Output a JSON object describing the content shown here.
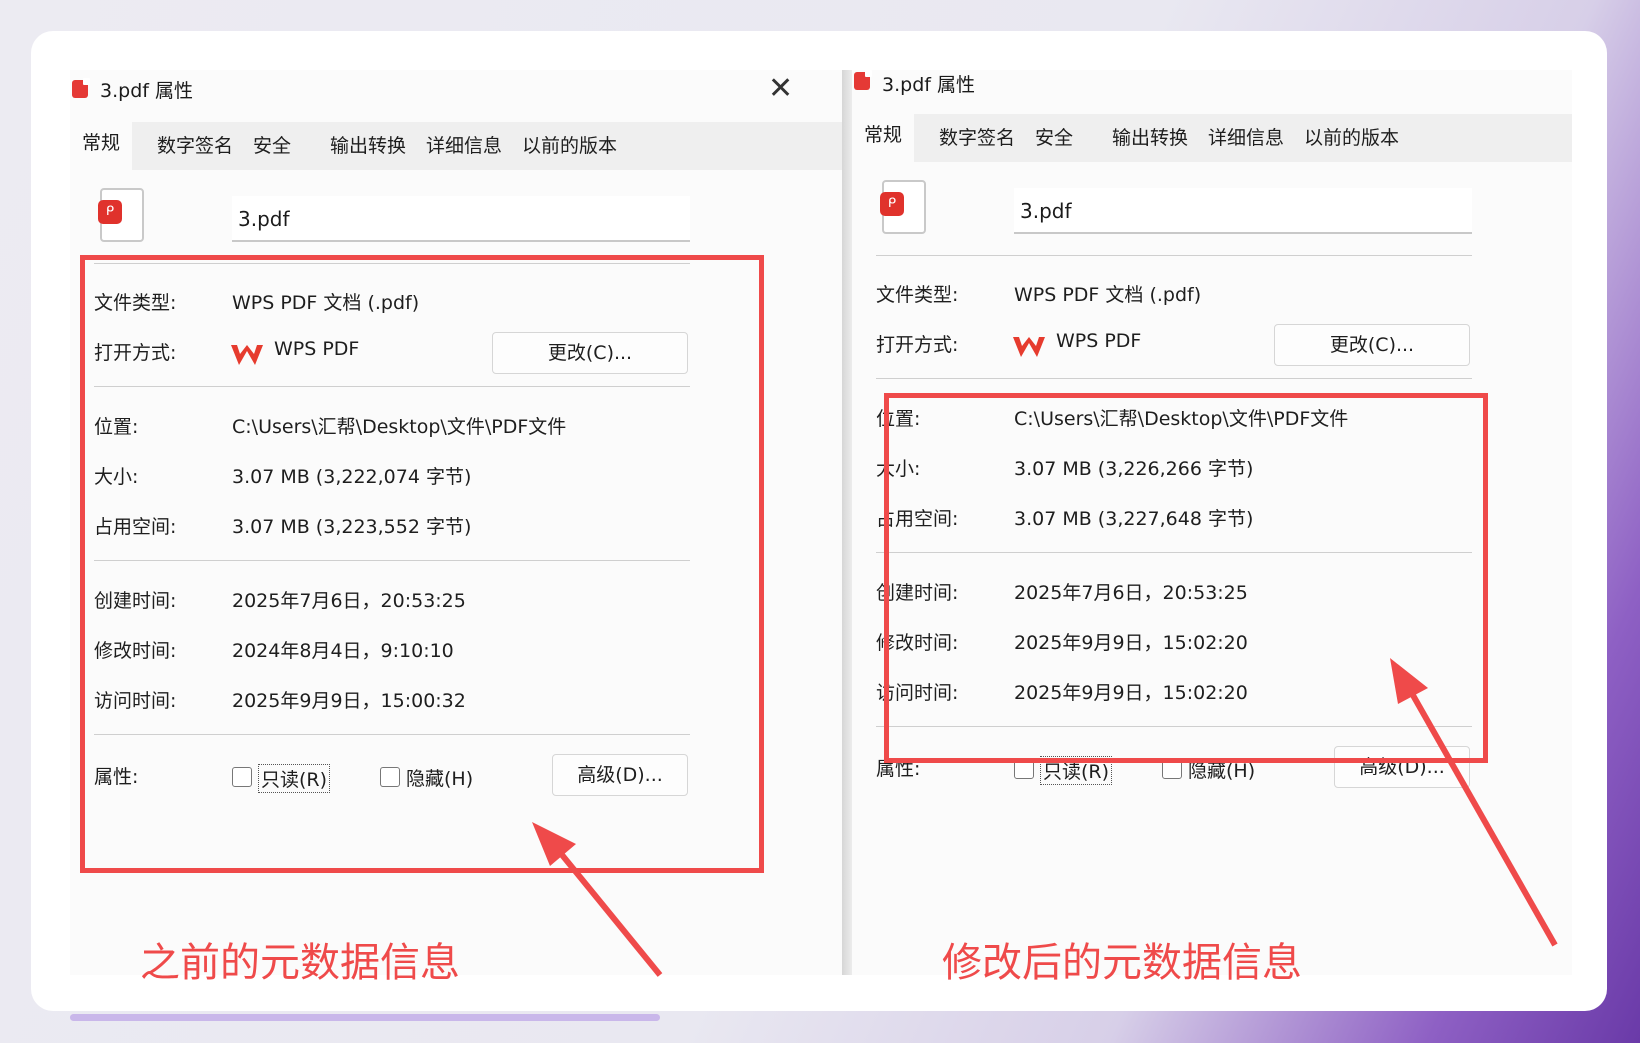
{
  "left": {
    "window_title": "3.pdf 属性",
    "tabs": [
      "常规",
      "数字签名",
      "安全",
      "输出转换",
      "详细信息",
      "以前的版本"
    ],
    "file_name": "3.pdf",
    "rows": {
      "type_label": "文件类型:",
      "type_value": "WPS PDF 文档 (.pdf)",
      "open_label": "打开方式:",
      "open_value": "WPS PDF",
      "change_button": "更改(C)...",
      "location_label": "位置:",
      "location_value": "C:\\Users\\汇帮\\Desktop\\文件\\PDF文件",
      "size_label": "大小:",
      "size_value": "3.07 MB (3,222,074 字节)",
      "disk_label": "占用空间:",
      "disk_value": "3.07 MB (3,223,552 字节)",
      "created_label": "创建时间:",
      "created_value": "2025年7月6日，20:53:25",
      "modified_label": "修改时间:",
      "modified_value": "2024年8月4日，9:10:10",
      "accessed_label": "访问时间:",
      "accessed_value": "2025年9月9日，15:00:32",
      "attr_label": "属性:",
      "readonly_label": "只读(R)",
      "hidden_label": "隐藏(H)",
      "advanced_button": "高级(D)..."
    },
    "caption": "之前的元数据信息"
  },
  "right": {
    "window_title": "3.pdf 属性",
    "tabs": [
      "常规",
      "数字签名",
      "安全",
      "输出转换",
      "详细信息",
      "以前的版本"
    ],
    "file_name": "3.pdf",
    "rows": {
      "type_label": "文件类型:",
      "type_value": "WPS PDF 文档 (.pdf)",
      "open_label": "打开方式:",
      "open_value": "WPS PDF",
      "change_button": "更改(C)...",
      "location_label": "位置:",
      "location_value": "C:\\Users\\汇帮\\Desktop\\文件\\PDF文件",
      "size_label": "大小:",
      "size_value": "3.07 MB (3,226,266 字节)",
      "disk_label": "占用空间:",
      "disk_value": "3.07 MB (3,227,648 字节)",
      "created_label": "创建时间:",
      "created_value": "2025年7月6日，20:53:25",
      "modified_label": "修改时间:",
      "modified_value": "2025年9月9日，15:02:20",
      "accessed_label": "访问时间:",
      "accessed_value": "2025年9月9日，15:02:20",
      "attr_label": "属性:",
      "readonly_label": "只读(R)",
      "hidden_label": "隐藏(H)",
      "advanced_button": "高级(D)..."
    },
    "caption": "修改后的元数据信息"
  },
  "colors": {
    "annotation_red": "#ef4a4a",
    "pdf_red": "#e0322c",
    "wps_red": "#e63b2e"
  },
  "icons": [
    "pdf-file-icon",
    "close-icon",
    "wps-logo-icon",
    "checkbox-icon",
    "arrow-annotation"
  ]
}
